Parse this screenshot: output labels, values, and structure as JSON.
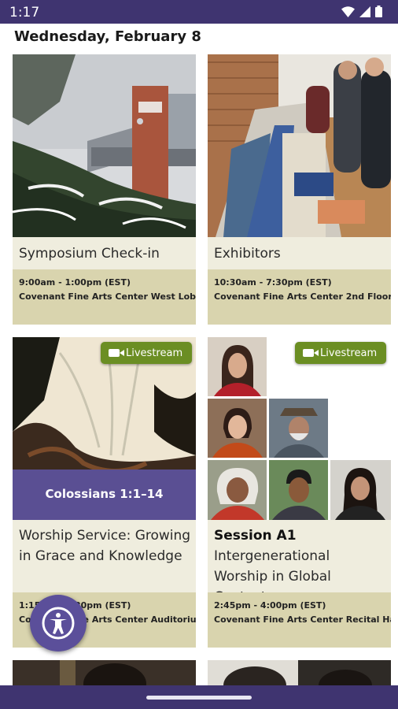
{
  "status_bar": {
    "time": "1:17"
  },
  "date_header": "Wednesday, February 8",
  "events": [
    {
      "title": "Symposium Check-in",
      "time": "9:00am - 1:00pm (EST)",
      "location": "Covenant Fine Arts Center West Lobby"
    },
    {
      "title": "Exhibitors",
      "time": "10:30am - 7:30pm (EST)",
      "location": "Covenant Fine Arts Center 2nd Floor"
    },
    {
      "title": "Worship Service: Growing in Grace and Knowledge",
      "time": "1:15pm - 2:30pm (EST)",
      "location": "Covenant Fine Arts Center Auditorium",
      "livestream": "Livestream",
      "image_caption": "Colossians 1:1–14"
    },
    {
      "session": "Session A1",
      "title": "Intergenerational Worship in Global Contexts",
      "time": "2:45pm - 4:00pm (EST)",
      "location": "Covenant Fine Arts Center Recital Hall",
      "livestream": "Livestream"
    }
  ],
  "accessibility_button": {
    "icon": "accessibility-icon"
  },
  "colors": {
    "brand": "#3f3470",
    "card": "#efedde",
    "meta": "#d9d4ae",
    "livestream": "#6b8e23",
    "fab": "#5b4f9a"
  }
}
